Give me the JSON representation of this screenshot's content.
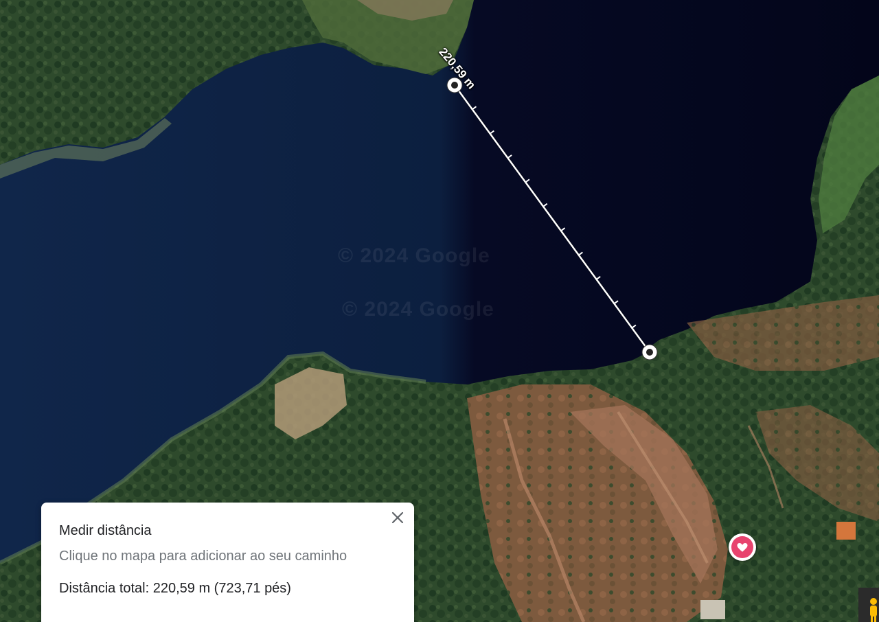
{
  "map": {
    "watermarks": [
      "© 2024 Google",
      "© 2024 Google"
    ],
    "measure_line_label": "220,59 m",
    "favorite_pin_icon": "heart-icon",
    "pegman_icon": "pegman-icon"
  },
  "measure_panel": {
    "title": "Medir distância",
    "hint": "Clique no mapa para adicionar ao seu caminho",
    "total": "Distância total: 220,59 m (723,71 pés)",
    "close_icon": "close-icon"
  },
  "colors": {
    "water_light": "#0e2241",
    "water_dark": "#04061a",
    "vegetation": "#2f4a2c",
    "soil": "#8a5a3c",
    "measure_line": "#ffffff",
    "favorite_pin": "#e8436e"
  }
}
